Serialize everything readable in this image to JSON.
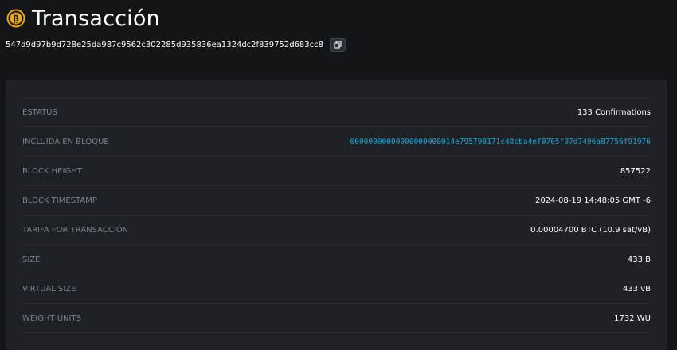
{
  "header": {
    "title": "Transacción",
    "icon": "bitcoin-icon",
    "accent": "#f2a900"
  },
  "txid": {
    "value": "547d9d97b9d728e25da987c9562c302285d935836ea1324dc2f839752d683cc8",
    "copy_icon": "copy-icon"
  },
  "details": {
    "rows": [
      {
        "label": "ESTATUS",
        "value": "133 Confirmations"
      },
      {
        "label": "INCLUIDA EN BLOQUE",
        "value": "00000000000000000000014e795798171c48cba4ef0705f07d7496a87756f91976"
      },
      {
        "label": "BLOCK HEIGHT",
        "value": "857522"
      },
      {
        "label": "BLOCK TIMESTAMP",
        "value": "2024-08-19 14:48:05 GMT -6"
      },
      {
        "label": "TARIFA FOR TRANSACCIÓN",
        "value": "0.00004700 BTC (10.9 sat/vB)"
      },
      {
        "label": "SIZE",
        "value": "433 B"
      },
      {
        "label": "VIRTUAL SIZE",
        "value": "433 vB"
      },
      {
        "label": "WEIGHT UNITS",
        "value": "1732 WU"
      }
    ]
  },
  "colors": {
    "background": "#131518",
    "card": "#1e2126",
    "link": "#1fa6d6",
    "label": "#7d838c"
  }
}
